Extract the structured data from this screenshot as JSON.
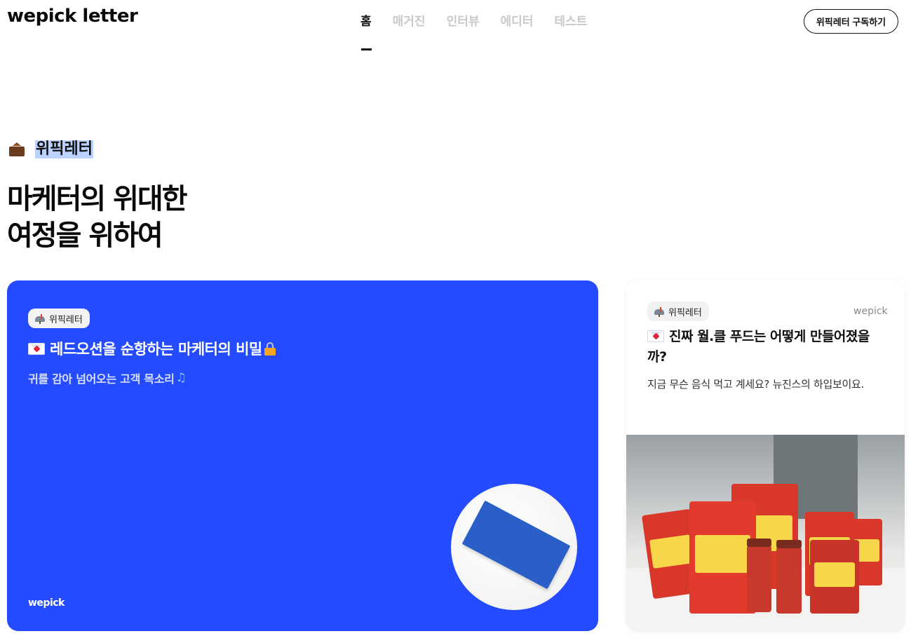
{
  "header": {
    "logo": "wepick letter",
    "nav": [
      "홈",
      "매거진",
      "인터뷰",
      "에디터",
      "테스트"
    ],
    "active_nav": "홈",
    "subscribe_label": "위픽레터 구독하기"
  },
  "hero": {
    "section_title": "위픽레터",
    "headline_line1": "마케터의 위대한",
    "headline_line2": "여정을 위하여"
  },
  "featured_card": {
    "tag": "위픽레터",
    "title": "레드오션을 순항하는 마케터의 비밀",
    "subtitle": "귀를 감아 넘어오는 고객 목소리",
    "brand": "wepick",
    "background_color": "#244bff"
  },
  "side_card": {
    "tag": "위픽레터",
    "source": "wepick",
    "title": "진짜 월.클 푸드는 어떻게 만들어졌을까?",
    "description": "지금 무슨 음식 먹고 계세요? 뉴진스의 하입보이요."
  },
  "icons": {
    "section": "envelope-with-letter-icon",
    "tag": "mailbox-icon",
    "title": "love-letter-icon",
    "lock": "lock-icon",
    "music": "music-note-icon"
  }
}
